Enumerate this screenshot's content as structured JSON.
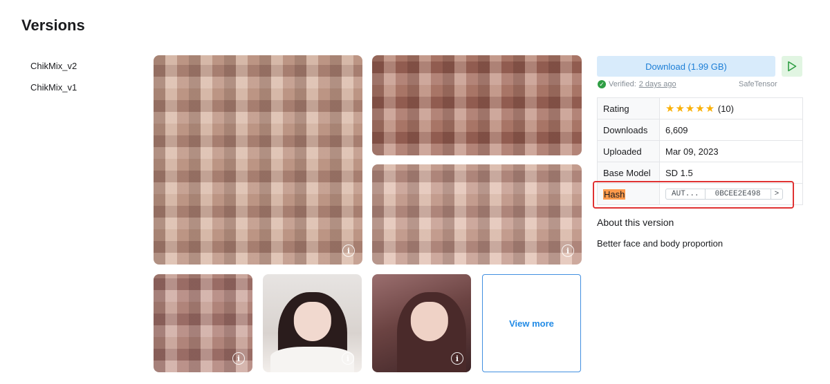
{
  "page": {
    "title": "Versions"
  },
  "versions": [
    {
      "label": "ChikMix_v2"
    },
    {
      "label": "ChikMix_v1"
    }
  ],
  "gallery": {
    "info_glyph": "i",
    "view_more_label": "View more"
  },
  "sidebar": {
    "download_label": "Download (1.99 GB)",
    "verified_label": "Verified:",
    "verified_time": "2 days ago",
    "file_format": "SafeTensor",
    "details": {
      "rating_label": "Rating",
      "rating_stars": "★★★★★",
      "rating_count": "(10)",
      "rating_value": 5,
      "downloads_label": "Downloads",
      "downloads_value": "6,609",
      "uploaded_label": "Uploaded",
      "uploaded_value": "Mar 09, 2023",
      "base_model_label": "Base Model",
      "base_model_value": "SD 1.5",
      "hash_label": "Hash",
      "hash_type": "AUT...",
      "hash_value": "0BCEE2E498",
      "hash_next": ">"
    },
    "about_title": "About this version",
    "about_text": "Better face and body proportion"
  },
  "colors": {
    "accent": "#228be6",
    "download_bg": "#d8ebfb",
    "play_bg": "#e1f5e2",
    "verified": "#2f9e44",
    "star": "#fab005",
    "highlight_border": "#e03131",
    "hash_label_bg": "#fd9a4b"
  },
  "icons": [
    "info-icon",
    "play-icon",
    "check-circle-icon",
    "star-icon",
    "chevron-right-icon"
  ]
}
